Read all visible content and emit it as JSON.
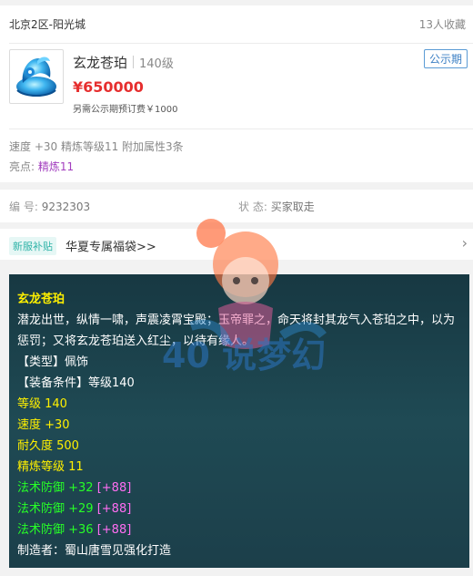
{
  "header": {
    "server": "北京2区-阳光城",
    "favorites": "13人收藏"
  },
  "item": {
    "name": "玄龙苍珀",
    "level": "140级",
    "badge": "公示期",
    "price": "¥650000",
    "deposit": "另需公示期预订费￥1000",
    "icon": "jade-ornament-icon"
  },
  "summary": {
    "stats": "速度 +30 精炼等级11 附加属性3条",
    "highlight_label": "亮点:",
    "highlight_value": "精炼11"
  },
  "meta": {
    "code_label": "编 号:",
    "code_value": "9232303",
    "status_label": "状 态:",
    "status_value": "买家取走"
  },
  "promo": {
    "tag": "新服补贴",
    "text": "华夏专属福袋>>",
    "arrow": "›"
  },
  "description": {
    "title": "玄龙苍珀",
    "lore": "潜龙出世，纵情一啸，声震凌霄宝殿；玉帝罪之，命天将封其龙气入苍珀之中，以为惩罚；又将玄龙苍珀送入红尘，以待有缘人。",
    "type": "【类型】佩饰",
    "requirement": "【装备条件】等级140",
    "level": "等级 140",
    "speed": "速度 +30",
    "durability": "耐久度 500",
    "refine": "精炼等级 11",
    "magic_def": [
      {
        "base": "法术防御 +32",
        "bonus": "[+88]"
      },
      {
        "base": "法术防御 +29",
        "bonus": "[+88]"
      },
      {
        "base": "法术防御 +36",
        "bonus": "[+88]"
      }
    ],
    "maker": "制造者：蜀山唐雪见强化打造"
  },
  "colors": {
    "price": "#e62e2e",
    "badge": "#3b7fc4",
    "highlight": "#a33fbf",
    "panel_bg": "#1c3f4a",
    "yellow": "#fff000",
    "green": "#27ff27",
    "pink": "#ff6ef2"
  },
  "watermark": {
    "text": "40 说梦幻"
  }
}
